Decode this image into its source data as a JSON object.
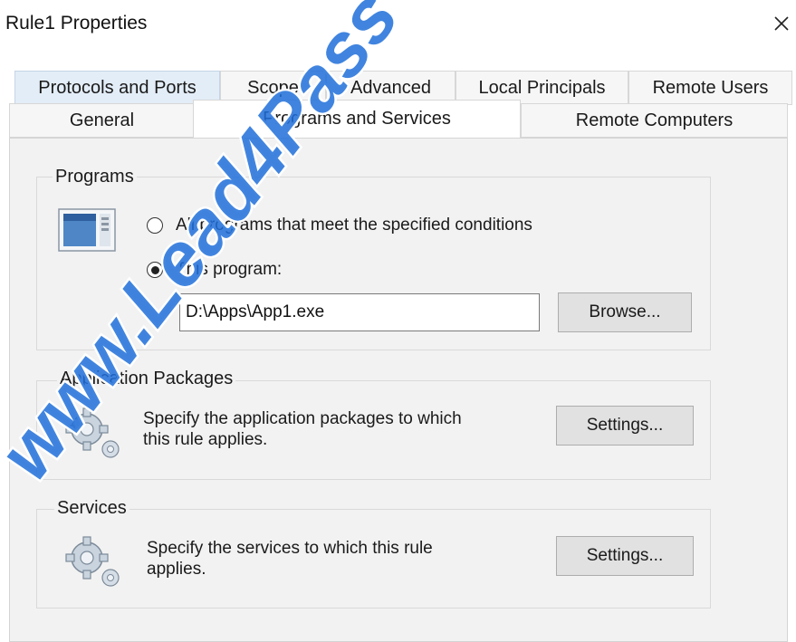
{
  "window": {
    "title": "Rule1 Properties",
    "close_glyph": "✕"
  },
  "tabs": {
    "row1": [
      {
        "label": "Protocols and Ports"
      },
      {
        "label": "Scope"
      },
      {
        "label": "Advanced"
      },
      {
        "label": "Local Principals"
      },
      {
        "label": "Remote Users"
      }
    ],
    "row2": [
      {
        "label": "General"
      },
      {
        "label": "Programs and Services",
        "active": true
      },
      {
        "label": "Remote Computers"
      }
    ]
  },
  "programs": {
    "group_label": "Programs",
    "icon": "program-window-icon",
    "option_all": {
      "label": "All programs that meet the specified conditions",
      "selected": false
    },
    "option_this": {
      "label": "This program:",
      "selected": true
    },
    "path_value": "D:\\Apps\\App1.exe",
    "browse_label": "Browse..."
  },
  "application_packages": {
    "group_label": "Application Packages",
    "icon": "gears-icon",
    "description_line1": "Specify the application packages to which",
    "description_line2": "this rule applies.",
    "settings_label": "Settings..."
  },
  "services": {
    "group_label": "Services",
    "icon": "gears-icon",
    "description_line1": "Specify the services to which this rule",
    "description_line2": "applies.",
    "settings_label": "Settings..."
  },
  "watermark": {
    "text": "www.Lead4Pass"
  },
  "colors": {
    "panel_bg": "#f2f2f2",
    "button_bg": "#e1e1e1",
    "watermark_fill": "#1e6fd9",
    "icon_blue": "#3a78c2"
  }
}
